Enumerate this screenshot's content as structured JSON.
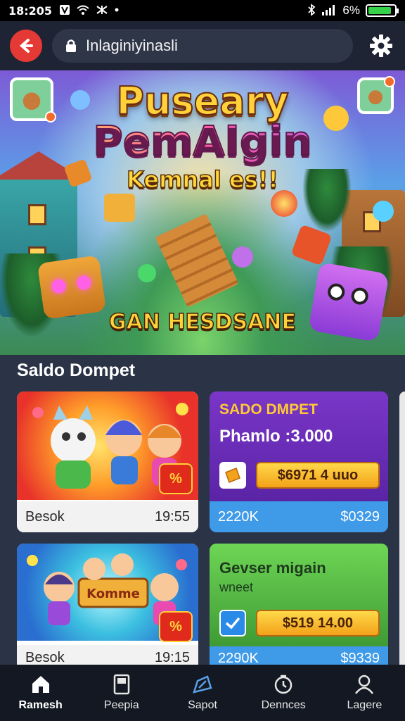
{
  "status_bar": {
    "time": "18:205",
    "battery_text": "6%",
    "battery_level": 0.9
  },
  "browser": {
    "url": "Inlaginiyinasli"
  },
  "banner": {
    "title_line1": "Puseary",
    "title_line2": "PemAIgin",
    "title_line3": "Kemnal es!!",
    "cta": "GAN HESDSANE"
  },
  "section": {
    "title": "Saldo Dompet"
  },
  "cards": [
    {
      "badge": "%",
      "footer_left": "Besok",
      "footer_right": "19:55"
    },
    {
      "title": "SADO DMPET",
      "subtitle": "Phamlo :3.000",
      "amount": "$6971 4 uuo",
      "footer_left": "2220K",
      "footer_right": "$0329"
    },
    {
      "badge": "%",
      "art_label": "Komme",
      "footer_left": "Besok",
      "footer_right": "19:15"
    },
    {
      "title": "Gevser migain",
      "subtitle": "wneet",
      "amount": "$519 14.00",
      "footer_left": "2290K",
      "footer_right": "$9339"
    }
  ],
  "bottom_nav": [
    {
      "label": "Ramesh",
      "icon": "home-icon"
    },
    {
      "label": "Peepia",
      "icon": "tablet-icon"
    },
    {
      "label": "Sapot",
      "icon": "map-icon"
    },
    {
      "label": "Dennces",
      "icon": "clock-icon"
    },
    {
      "label": "Lagere",
      "icon": "user-icon"
    }
  ],
  "colors": {
    "accent": "#e53935",
    "nav_bg": "#141823",
    "page_bg": "#2b3446"
  }
}
